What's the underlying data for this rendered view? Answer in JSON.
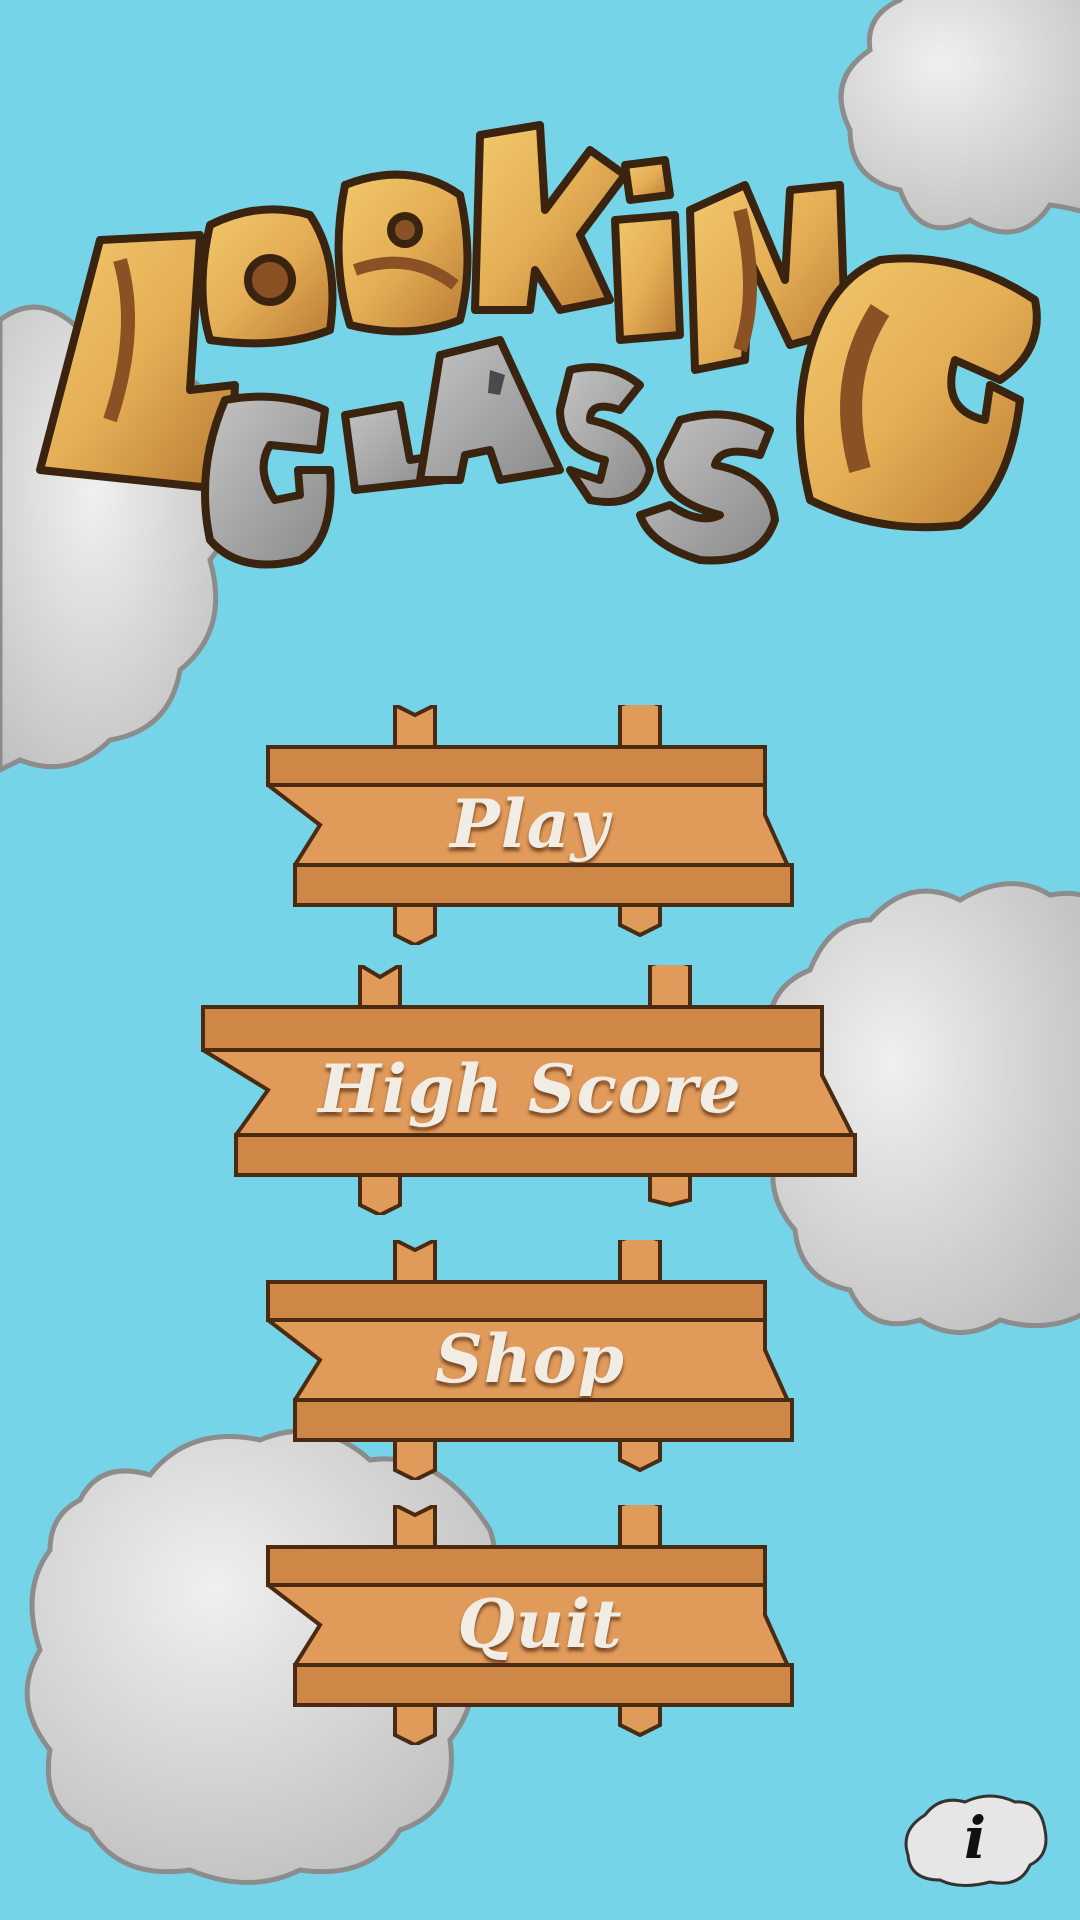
{
  "title": {
    "line1": "LOOKING",
    "line2": "GLASS",
    "letters_top": [
      "L",
      "O",
      "O",
      "K",
      "i",
      "N"
    ],
    "letters_bottom": [
      "G",
      "L",
      "A",
      "S",
      "S"
    ],
    "big_letter": "G"
  },
  "menu": {
    "play": "Play",
    "high_score": "High Score",
    "shop": "Shop",
    "quit": "Quit"
  },
  "info_button": {
    "label": "i"
  },
  "colors": {
    "sky": "#75d4e8",
    "cloud": "#dcdcdc",
    "wood": "#e09a5a",
    "wood_dark": "#6b3f1c",
    "title_wood": "#eab95f",
    "title_stone": "#a5a5a5",
    "label": "#f2ede4"
  }
}
